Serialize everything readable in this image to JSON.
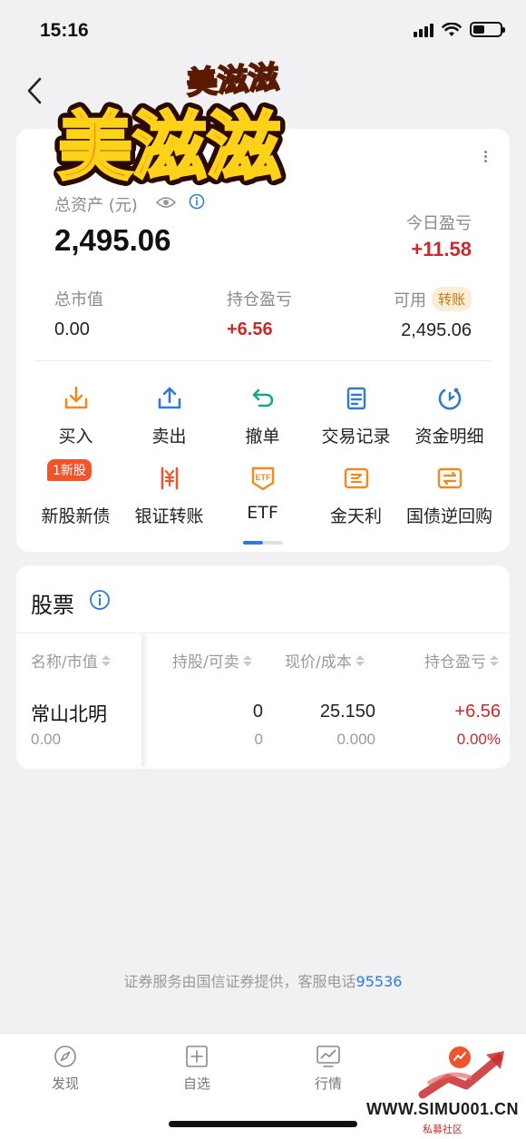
{
  "status_bar": {
    "time": "15:16"
  },
  "sticker": {
    "big_text": "美滋滋",
    "small_text": "美滋滋"
  },
  "assets": {
    "total_label": "总资产 (元)",
    "total_value": "2,495.06",
    "today_pnl_label": "今日盈亏",
    "today_pnl_value": "+11.58",
    "market_value_label": "总市值",
    "market_value": "0.00",
    "position_pnl_label": "持仓盈亏",
    "position_pnl_value": "+6.56",
    "available_label": "可用",
    "transfer_label": "转账",
    "available_value": "2,495.06"
  },
  "actions_row1": [
    {
      "label": "买入",
      "icon": "buy-icon",
      "color": "#f08a1c"
    },
    {
      "label": "卖出",
      "icon": "sell-icon",
      "color": "#2f7ad6"
    },
    {
      "label": "撤单",
      "icon": "undo-icon",
      "color": "#18a589"
    },
    {
      "label": "交易记录",
      "icon": "record-icon",
      "color": "#2f7ad6"
    },
    {
      "label": "资金明细",
      "icon": "fund-detail-icon",
      "color": "#2f7ad6"
    }
  ],
  "actions_row2": [
    {
      "label": "新股新债",
      "badge": "1新股"
    },
    {
      "label": "银证转账",
      "icon": "bank-transfer-icon",
      "color": "#f0542c"
    },
    {
      "label": "ETF",
      "icon": "etf-icon",
      "icon_text": "ETF",
      "color": "#f08a1c"
    },
    {
      "label": "金天利",
      "icon": "jintianli-icon",
      "color": "#f08a1c"
    },
    {
      "label": "国债逆回购",
      "icon": "repo-icon",
      "color": "#f08a1c"
    }
  ],
  "stocks": {
    "title": "股票",
    "columns": [
      "名称/市值",
      "持股/可卖",
      "现价/成本",
      "持仓盈亏"
    ],
    "rows": [
      {
        "name": "常山北明",
        "market_value": "0.00",
        "holding": "0",
        "sellable": "0",
        "price": "25.150",
        "cost": "0.000",
        "pnl": "+6.56",
        "pnl_pct": "0.00%"
      }
    ]
  },
  "footer": {
    "note": "证券服务由国信证券提供，客服电话",
    "phone": "95536"
  },
  "tabs": [
    {
      "label": "发现",
      "icon": "compass-icon"
    },
    {
      "label": "自选",
      "icon": "add-favorite-icon"
    },
    {
      "label": "行情",
      "icon": "market-chart-icon"
    }
  ],
  "watermark": {
    "text": "WWW.SIMU001.CN",
    "sub": "私募社区"
  },
  "colors": {
    "up_red": "#cc2a2a",
    "accent_blue": "#2f7ad6",
    "orange": "#f08a1c"
  }
}
